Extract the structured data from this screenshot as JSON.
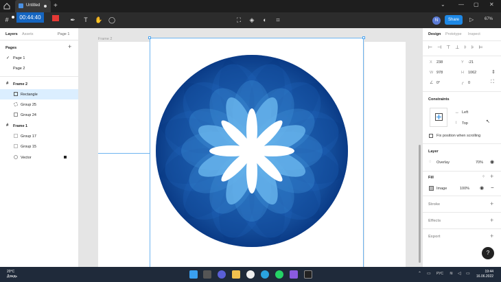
{
  "window": {
    "tab_title": "Untitled",
    "controls": {
      "minimize": "—",
      "restore": "▢",
      "close": "✕",
      "more": "⌄"
    }
  },
  "recorder": {
    "time": "00:44:40"
  },
  "toolbar": {
    "avatar_initial": "N",
    "share_label": "Share",
    "zoom": "67%"
  },
  "left_panel": {
    "tabs": [
      "Layers",
      "Assets"
    ],
    "page_selector": "Page 1",
    "pages_title": "Pages",
    "pages": [
      "Page 1",
      "Page 2"
    ],
    "layers": [
      {
        "name": "Frame 2",
        "type": "frame",
        "level": 0
      },
      {
        "name": "Rectangle",
        "type": "image",
        "level": 1,
        "selected": true
      },
      {
        "name": "Group 25",
        "type": "group",
        "level": 1
      },
      {
        "name": "Group 24",
        "type": "group",
        "level": 1
      },
      {
        "name": "Frame 1",
        "type": "frame",
        "level": 0
      },
      {
        "name": "Group 17",
        "type": "group",
        "level": 1
      },
      {
        "name": "Group 15",
        "type": "group",
        "level": 1
      },
      {
        "name": "Vector",
        "type": "vector",
        "level": 1
      }
    ]
  },
  "canvas": {
    "frame_label": "Frame 2",
    "accent_color": "#4aa3f0",
    "artwork": "blue-mandala-circle"
  },
  "right_panel": {
    "tabs": [
      "Design",
      "Prototype",
      "Inspect"
    ],
    "position": {
      "x_label": "X",
      "x": "238",
      "y_label": "Y",
      "y": "-21"
    },
    "size": {
      "w_label": "W",
      "w": "978",
      "h_label": "H",
      "h": "1062"
    },
    "rotation": "0°",
    "corner_radius": "0",
    "constraints_title": "Constraints",
    "constraint_h": "Left",
    "constraint_v": "Top",
    "fix_position_label": "Fix position when scrolling",
    "layer_title": "Layer",
    "blend_mode": "Overlay",
    "layer_opacity": "70%",
    "fill_title": "Fill",
    "fill_type": "Image",
    "fill_opacity": "100%",
    "stroke_title": "Stroke",
    "effects_title": "Effects",
    "export_title": "Export",
    "help": "?"
  },
  "taskbar": {
    "weather_temp": "20°C",
    "weather_desc": "Дождь",
    "language": "РУС",
    "time": "19:44",
    "date": "16.06.2022"
  }
}
